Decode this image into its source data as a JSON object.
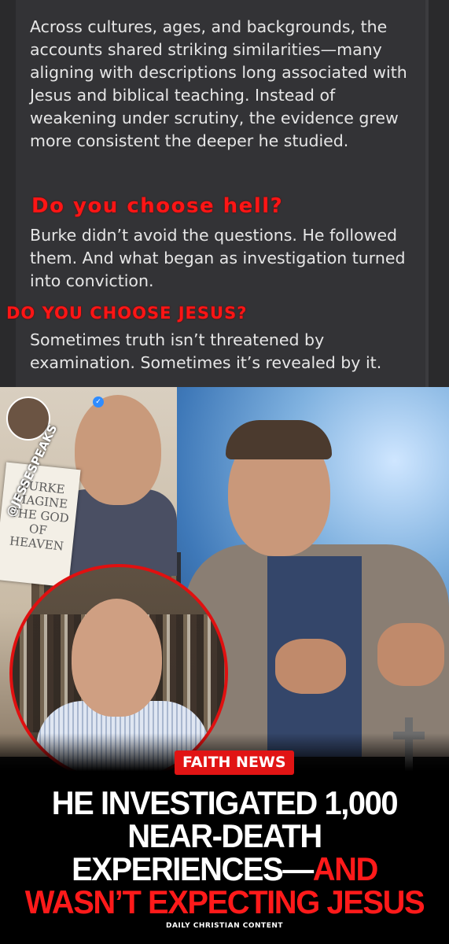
{
  "post": {
    "paragraph1": "Across cultures, ages, and backgrounds, the accounts shared striking similarities—many aligning with descriptions long associated with Jesus and biblical teaching. Instead of weakening under scrutiny, the evidence grew more consistent the deeper he studied.",
    "banner1": "Do you choose hell?",
    "paragraph2": "Burke didn’t avoid the questions. He followed them. And what began as investigation turned into conviction.",
    "banner2": "DO YOU CHOOSE JESUS?",
    "paragraph3": "Sometimes truth isn’t threatened by examination. Sometimes it’s revealed by it."
  },
  "thumbnail": {
    "handle": "@JESSESPEAKS",
    "book_title": "BURKE MAGINE THE GOD OF HEAVEN",
    "label": "FAITH NEWS",
    "headline_line1": "HE INVESTIGATED 1,000",
    "headline_line2": "NEAR-DEATH",
    "headline_line3_white": "EXPERIENCES—",
    "headline_line3_red": "AND",
    "headline_line4": "WASN’T EXPECTING JESUS",
    "footer": "DAILY CHRISTIAN CONTENT",
    "accent_color": "#ff1a1a"
  }
}
